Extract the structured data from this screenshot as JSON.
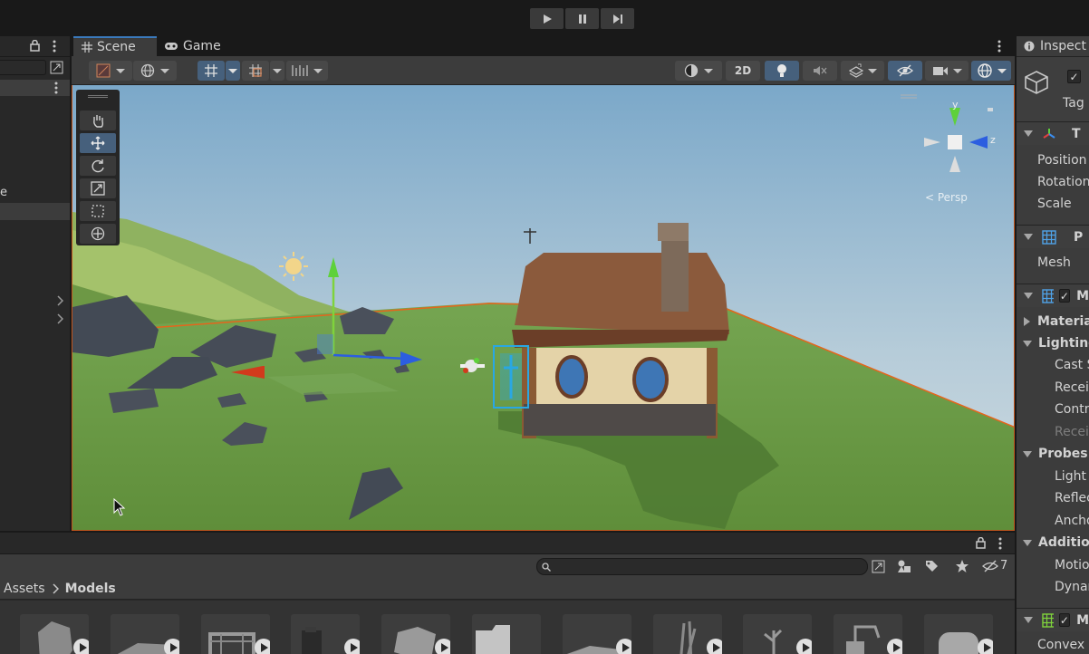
{
  "play_controls": {
    "play": "play-icon",
    "pause": "pause-icon",
    "step": "step-icon"
  },
  "hierarchy": {
    "visible_item": "e"
  },
  "scene_tabs": [
    {
      "label": "Scene",
      "icon": "grid-icon",
      "active": true
    },
    {
      "label": "Game",
      "icon": "gamepad-icon",
      "active": false
    }
  ],
  "scene_toolbar": {
    "toggle_2d": "2D"
  },
  "tools": [
    "hand-tool",
    "move-tool",
    "rotate-tool",
    "scale-tool",
    "rect-tool",
    "transform-tool"
  ],
  "gizmo": {
    "y": "y",
    "z": "z",
    "projection": "< Persp"
  },
  "inspector": {
    "tab": "Inspect",
    "tag_label": "Tag",
    "sections": [
      {
        "title": "T",
        "icon": "transform-icon",
        "rows": [
          "Position",
          "Rotation",
          "Scale"
        ]
      },
      {
        "title": "P",
        "icon": "mesh-filter-icon",
        "rows": [
          "Mesh"
        ]
      },
      {
        "title": "M",
        "icon": "mesh-renderer-icon"
      }
    ],
    "materials": "Materia",
    "lighting": "Lighting",
    "lighting_rows": [
      "Cast S",
      "Recei",
      "Contr",
      "Recei"
    ],
    "probes": "Probes",
    "probes_rows": [
      "Light",
      "Reflec",
      "Ancho"
    ],
    "additional": "Additio",
    "additional_rows": [
      "Motio",
      "Dynar"
    ],
    "collider_header": "M",
    "collider_row": "Convex"
  },
  "project": {
    "hidden_count": "7",
    "breadcrumb_root": "Assets",
    "breadcrumb_current": "Models",
    "assets": [
      {
        "kind": "rock"
      },
      {
        "kind": "plank"
      },
      {
        "kind": "cart"
      },
      {
        "kind": "box"
      },
      {
        "kind": "stone"
      },
      {
        "kind": "folder"
      },
      {
        "kind": "tile"
      },
      {
        "kind": "grass"
      },
      {
        "kind": "plant"
      },
      {
        "kind": "pump"
      },
      {
        "kind": "barrel"
      }
    ]
  },
  "colors": {
    "accent": "#3a79bb",
    "selection_outline": "#e5651c",
    "sky_top": "#7ba8c9",
    "ground": "#6a9a44"
  }
}
